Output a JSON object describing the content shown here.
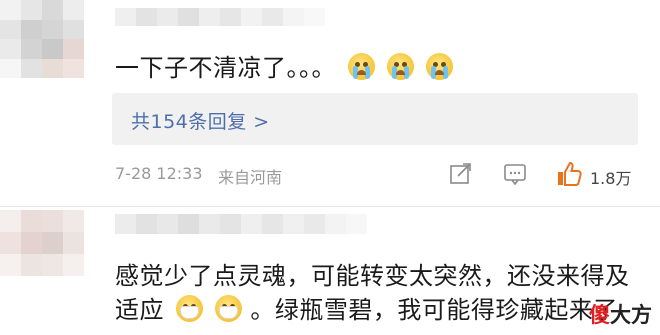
{
  "comment1": {
    "text": "一下子不清凉了。。。",
    "emoji": [
      "crying-face",
      "crying-face",
      "crying-face"
    ],
    "replies_label": "共154条回复 >",
    "date": "7-28 12:33",
    "location": "来自河南",
    "likes": "1.8万"
  },
  "comment2": {
    "line1": "感觉少了点灵魂，可能转变太突然，还没来得及",
    "line2_pre": "适应",
    "line2_post": "。绿瓶雪碧，我可能得珍藏起来了",
    "emoji": [
      "mask-face",
      "mask-face"
    ]
  },
  "watermark": {
    "first": "傻",
    "rest": "大方"
  },
  "colors": {
    "link": "#4f6fab",
    "meta": "#9a9a9a",
    "like_orange": "#e8731c",
    "reply_bg": "#f1f1f1"
  }
}
